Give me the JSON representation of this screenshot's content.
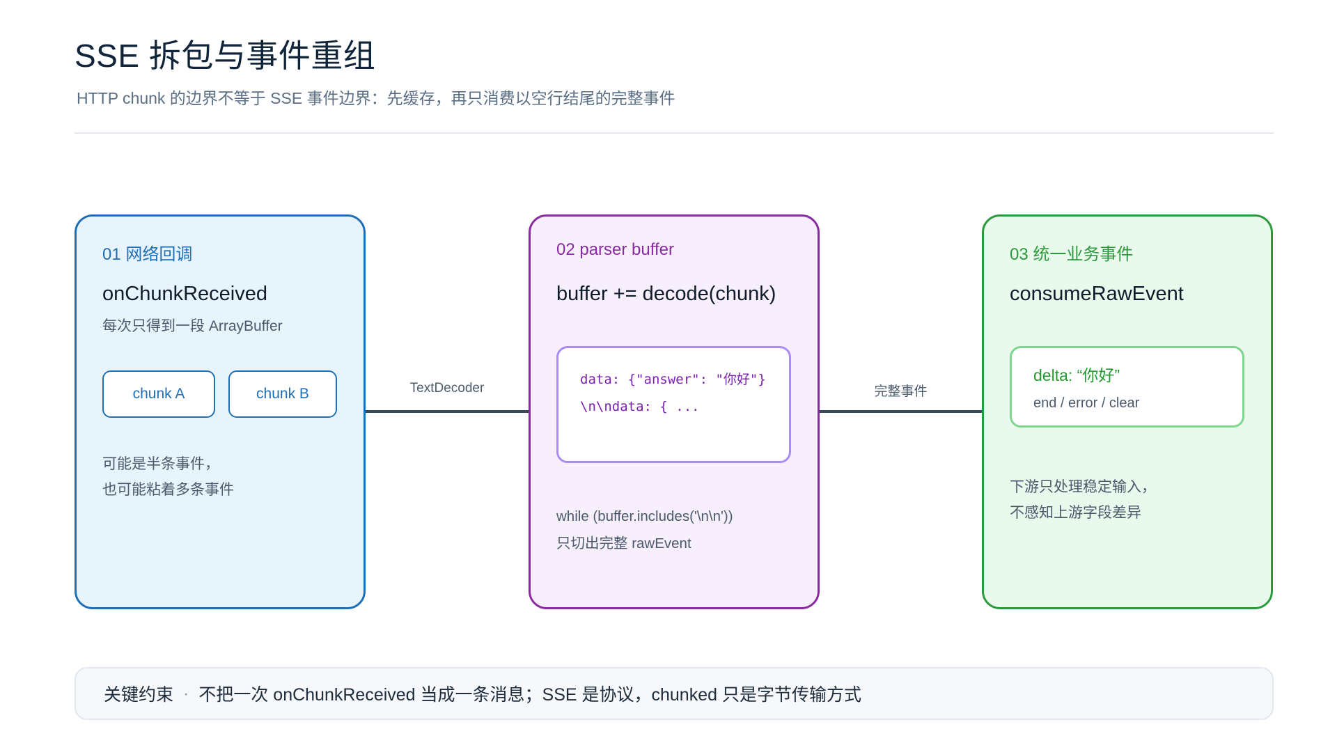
{
  "header": {
    "title": "SSE 拆包与事件重组",
    "subtitle": "HTTP chunk 的边界不等于 SSE 事件边界：先缓存，再只消费以空行结尾的完整事件"
  },
  "stages": [
    {
      "step": "01  网络回调",
      "head": "onChunkReceived",
      "desc": "每次只得到一段 ArrayBuffer",
      "chips": [
        "chunk A",
        "chunk B"
      ],
      "notes": [
        "可能是半条事件，",
        "也可能粘着多条事件"
      ]
    },
    {
      "step": "02  parser buffer",
      "head": "buffer += decode(chunk)",
      "code": "data: {\"answer\": \"你好\"}\\n\\ndata: { ...",
      "notes": [
        "while (buffer.includes('\\n\\n'))",
        "只切出完整 rawEvent"
      ]
    },
    {
      "step": "03  统一业务事件",
      "head": "consumeRawEvent",
      "output_main": "delta: “你好”",
      "output_sub": "end / error / clear",
      "notes": [
        "下游只处理稳定输入，",
        "不感知上游字段差异"
      ]
    }
  ],
  "connectors": [
    {
      "label": "TextDecoder"
    },
    {
      "label": "完整事件"
    }
  ],
  "footer": {
    "label": "关键约束",
    "separator": "·",
    "text": "不把一次 onChunkReceived 当成一条消息；SSE 是协议，chunked 只是字节传输方式"
  },
  "colors": {
    "stage1_border": "#1f6fb6",
    "stage1_fill": "#e8f4fc",
    "stage2_border": "#8a2aa2",
    "stage2_fill": "#f7effc",
    "stage3_border": "#2b9a3c",
    "stage3_fill": "#e9f9ec",
    "connector": "#3b4a5a"
  }
}
